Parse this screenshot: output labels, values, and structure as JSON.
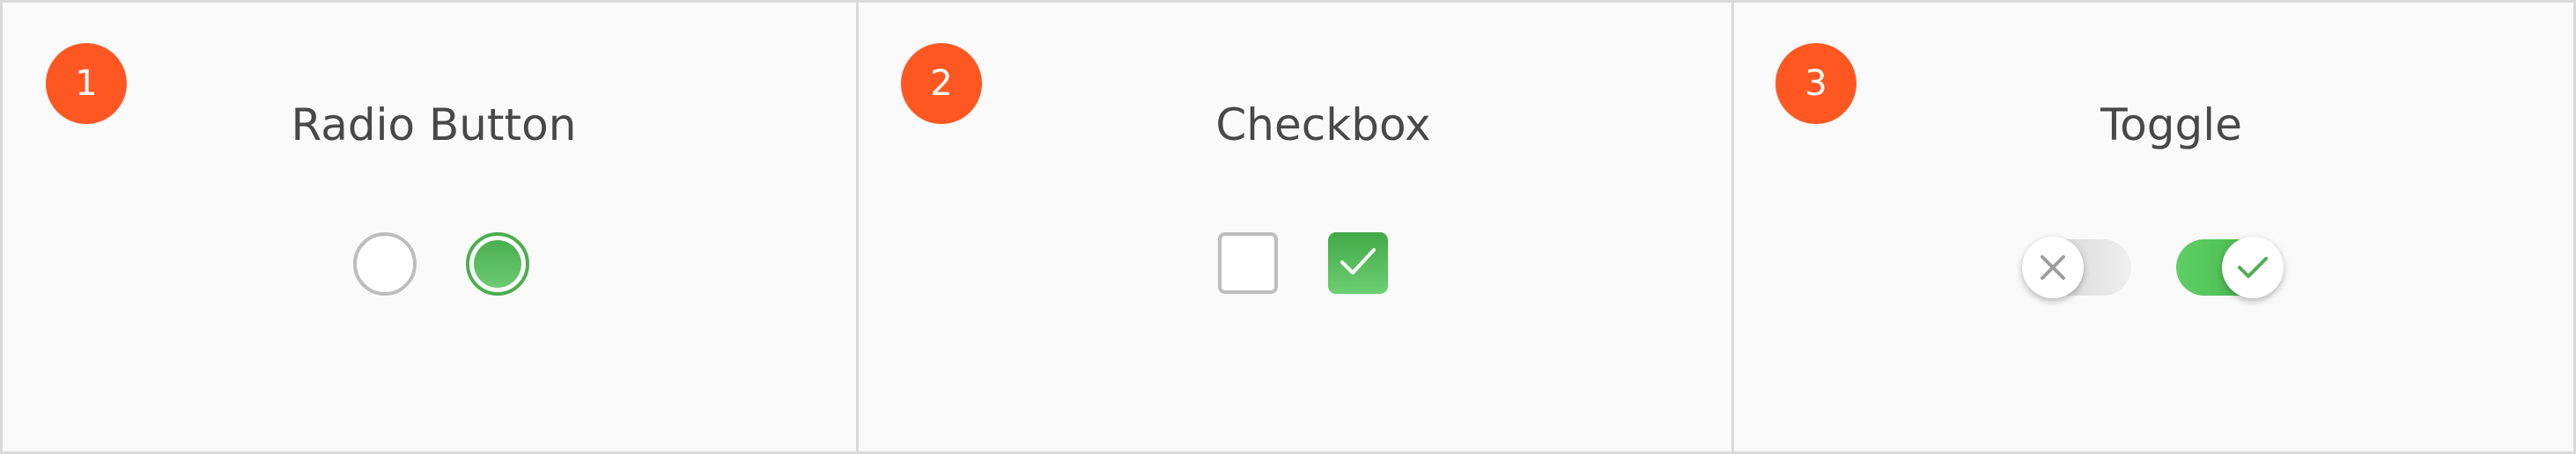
{
  "panels": [
    {
      "badge": "1",
      "title": "Radio Button"
    },
    {
      "badge": "2",
      "title": "Checkbox"
    },
    {
      "badge": "3",
      "title": "Toggle"
    }
  ],
  "controls": {
    "radio_unselected": {
      "state": "off"
    },
    "radio_selected": {
      "state": "on"
    },
    "checkbox_unchecked": {
      "state": "off"
    },
    "checkbox_checked": {
      "state": "on",
      "icon": "check-icon"
    },
    "toggle_off": {
      "state": "off",
      "icon": "close-icon"
    },
    "toggle_on": {
      "state": "on",
      "icon": "check-icon"
    }
  },
  "colors": {
    "badge": "#ff5722",
    "accent_green": "#4caf50",
    "inactive_border": "#bdbdbd",
    "title_text": "#484848"
  }
}
